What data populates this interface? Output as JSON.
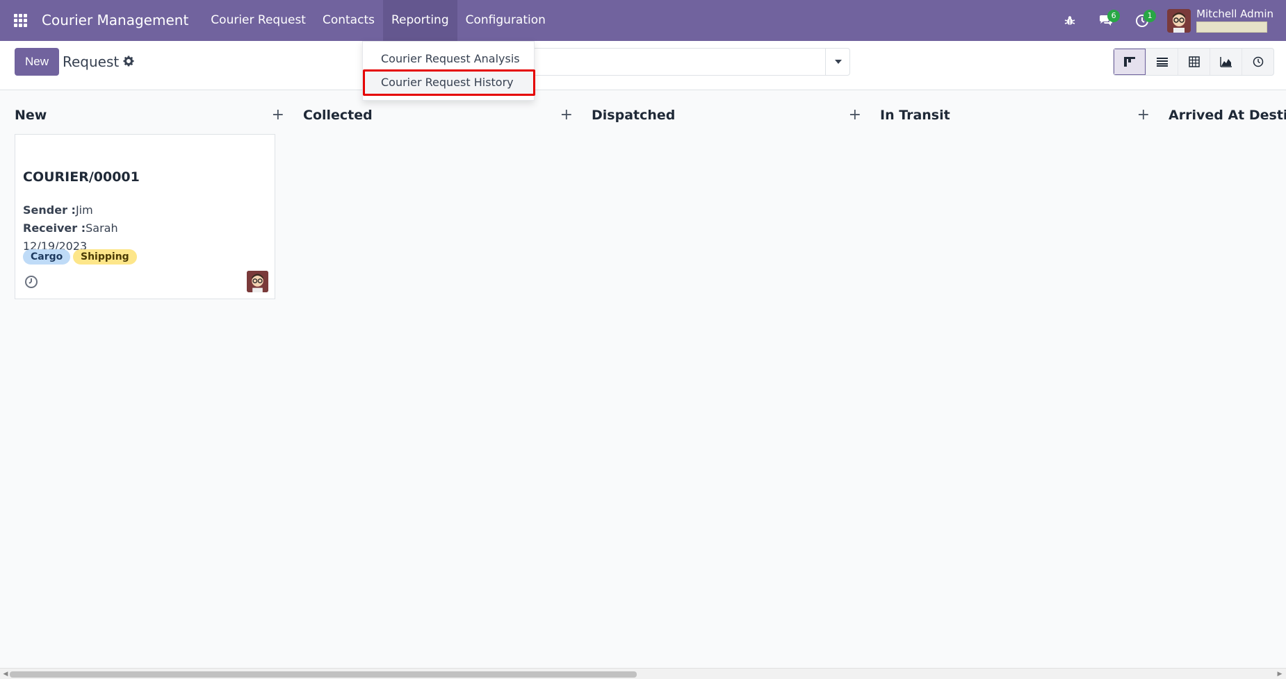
{
  "navbar": {
    "brand": "Courier Management",
    "menu": [
      "Courier Request",
      "Contacts",
      "Reporting",
      "Configuration"
    ],
    "messages_count": "6",
    "activities_count": "1",
    "user_name": "Mitchell Admin"
  },
  "control_panel": {
    "new_label": "New",
    "breadcrumb": "Request",
    "search_placeholder": "",
    "views": [
      "kanban",
      "list",
      "pivot",
      "graph",
      "activity"
    ],
    "active_view": "kanban"
  },
  "reporting_dropdown": {
    "items": [
      "Courier Request Analysis",
      "Courier Request History"
    ],
    "highlighted": "Courier Request History"
  },
  "kanban": {
    "columns": [
      {
        "title": "New"
      },
      {
        "title": "Collected"
      },
      {
        "title": "Dispatched"
      },
      {
        "title": "In Transit"
      },
      {
        "title": "Arrived At Destin"
      }
    ],
    "card": {
      "name": "COURIER/00001",
      "sender_label": "Sender :",
      "sender": "Jim",
      "receiver_label": "Receiver :",
      "receiver": "Sarah",
      "date": "12/19/2023",
      "tags": [
        "Cargo",
        "Shipping"
      ]
    }
  },
  "colors": {
    "navbar": "#71639e",
    "highlight": "#e50000"
  }
}
